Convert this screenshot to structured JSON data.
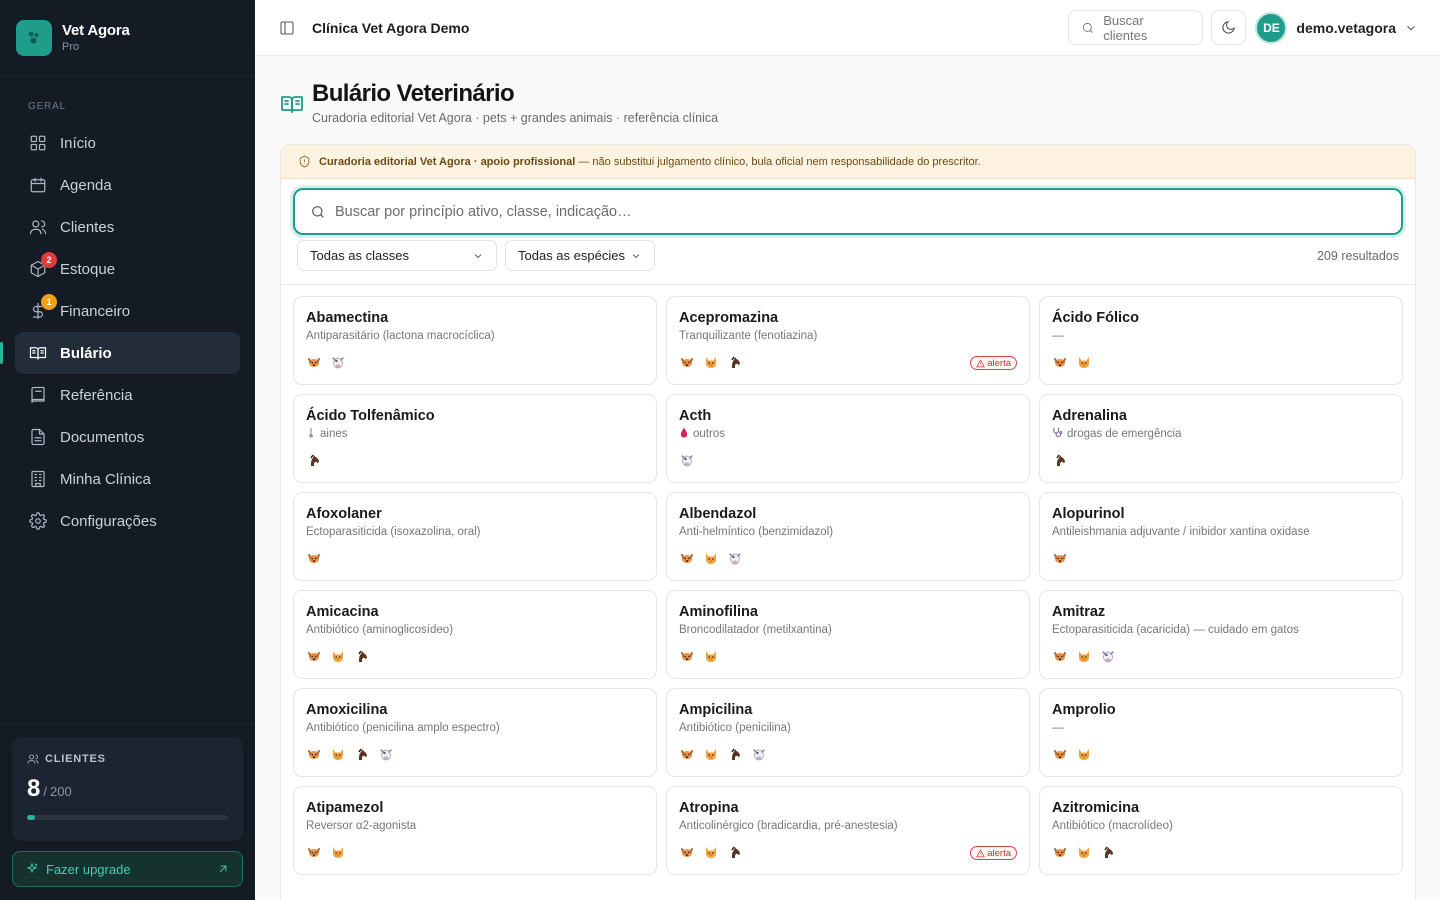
{
  "brand": {
    "name": "Vet Agora",
    "plan": "Pro"
  },
  "sidebar": {
    "section": "GERAL",
    "items": [
      {
        "label": "Início",
        "icon": "grid-icon"
      },
      {
        "label": "Agenda",
        "icon": "calendar-icon"
      },
      {
        "label": "Clientes",
        "icon": "users-icon"
      },
      {
        "label": "Estoque",
        "icon": "package-icon",
        "badge": "2",
        "badge_color": "#e03c3c"
      },
      {
        "label": "Financeiro",
        "icon": "dollar-icon",
        "badge": "1",
        "badge_color": "#f0a21a"
      },
      {
        "label": "Bulário",
        "icon": "book-open-icon",
        "active": true
      },
      {
        "label": "Referência",
        "icon": "book-icon"
      },
      {
        "label": "Documentos",
        "icon": "file-icon"
      },
      {
        "label": "Minha Clínica",
        "icon": "building-icon"
      },
      {
        "label": "Configurações",
        "icon": "gear-icon"
      }
    ],
    "quota": {
      "label": "CLIENTES",
      "used": "8",
      "sep": "/",
      "max": "200",
      "fraction": 0.04
    },
    "upgrade_label": "Fazer upgrade"
  },
  "topbar": {
    "clinic": "Clínica Vet Agora Demo",
    "search_label": "Buscar clientes",
    "user_initials": "DE",
    "user_name": "demo.vetagora"
  },
  "page": {
    "title": "Bulário Veterinário",
    "subtitle": "Curadoria editorial Vet Agora · pets + grandes animais · referência clínica",
    "notice_bold": "Curadoria editorial Vet Agora · apoio profissional",
    "notice_rest": " — não substitui julgamento clínico, bula oficial nem responsabilidade do prescritor.",
    "search_placeholder": "Buscar por princípio ativo, classe, indicação…",
    "filter_class": "Todas as classes",
    "filter_species": "Todas as espécies",
    "results": "209 resultados"
  },
  "colors": {
    "accent": "#1f9d8b",
    "sidebar_bg": "#141b25",
    "alert": "#d94545",
    "notice_bg": "#fdf3e0"
  },
  "drugs": [
    {
      "name": "Abamectina",
      "cls": "Antiparasitário (lactona macrocíclica)",
      "species": [
        "dog",
        "cow"
      ]
    },
    {
      "name": "Acepromazina",
      "cls": "Tranquilizante (fenotiazina)",
      "species": [
        "dog",
        "cat",
        "horse"
      ],
      "alert": "alerta"
    },
    {
      "name": "Ácido Fólico",
      "cls": "—",
      "species": [
        "dog",
        "cat"
      ]
    },
    {
      "name": "Ácido Tolfenâmico",
      "cls": "aines",
      "cls_icon": "thermometer-icon",
      "species": [
        "horse"
      ]
    },
    {
      "name": "Acth",
      "cls": "outros",
      "cls_icon": "drop-icon",
      "species": [
        "cow"
      ]
    },
    {
      "name": "Adrenalina",
      "cls": "drogas de emergência",
      "cls_icon": "stethoscope-icon",
      "species": [
        "horse"
      ]
    },
    {
      "name": "Afoxolaner",
      "cls": "Ectoparasiticida (isoxazolina, oral)",
      "species": [
        "dog"
      ]
    },
    {
      "name": "Albendazol",
      "cls": "Anti-helmíntico (benzimidazol)",
      "species": [
        "dog",
        "cat",
        "cow"
      ]
    },
    {
      "name": "Alopurinol",
      "cls": "Antileishmania adjuvante / inibidor xantina oxidase",
      "species": [
        "dog"
      ]
    },
    {
      "name": "Amicacina",
      "cls": "Antibiótico (aminoglicosídeo)",
      "species": [
        "dog",
        "cat",
        "horse"
      ]
    },
    {
      "name": "Aminofilina",
      "cls": "Broncodilatador (metilxantina)",
      "species": [
        "dog",
        "cat"
      ]
    },
    {
      "name": "Amitraz",
      "cls": "Ectoparasiticida (acaricida) — cuidado em gatos",
      "species": [
        "dog",
        "cat",
        "cow"
      ]
    },
    {
      "name": "Amoxicilina",
      "cls": "Antibiótico (penicilina amplo espectro)",
      "species": [
        "dog",
        "cat",
        "horse",
        "cow"
      ]
    },
    {
      "name": "Ampicilina",
      "cls": "Antibiótico (penicilina)",
      "species": [
        "dog",
        "cat",
        "horse",
        "cow"
      ]
    },
    {
      "name": "Amprolio",
      "cls": "—",
      "species": [
        "dog",
        "cat"
      ]
    },
    {
      "name": "Atipamezol",
      "cls": "Reversor α2-agonista",
      "species": [
        "dog",
        "cat"
      ]
    },
    {
      "name": "Atropina",
      "cls": "Anticolinérgico (bradicardia, pré-anestesia)",
      "species": [
        "dog",
        "cat",
        "horse"
      ],
      "alert": "alerta"
    },
    {
      "name": "Azitromicina",
      "cls": "Antibiótico (macrolídeo)",
      "species": [
        "dog",
        "cat",
        "horse"
      ]
    }
  ]
}
